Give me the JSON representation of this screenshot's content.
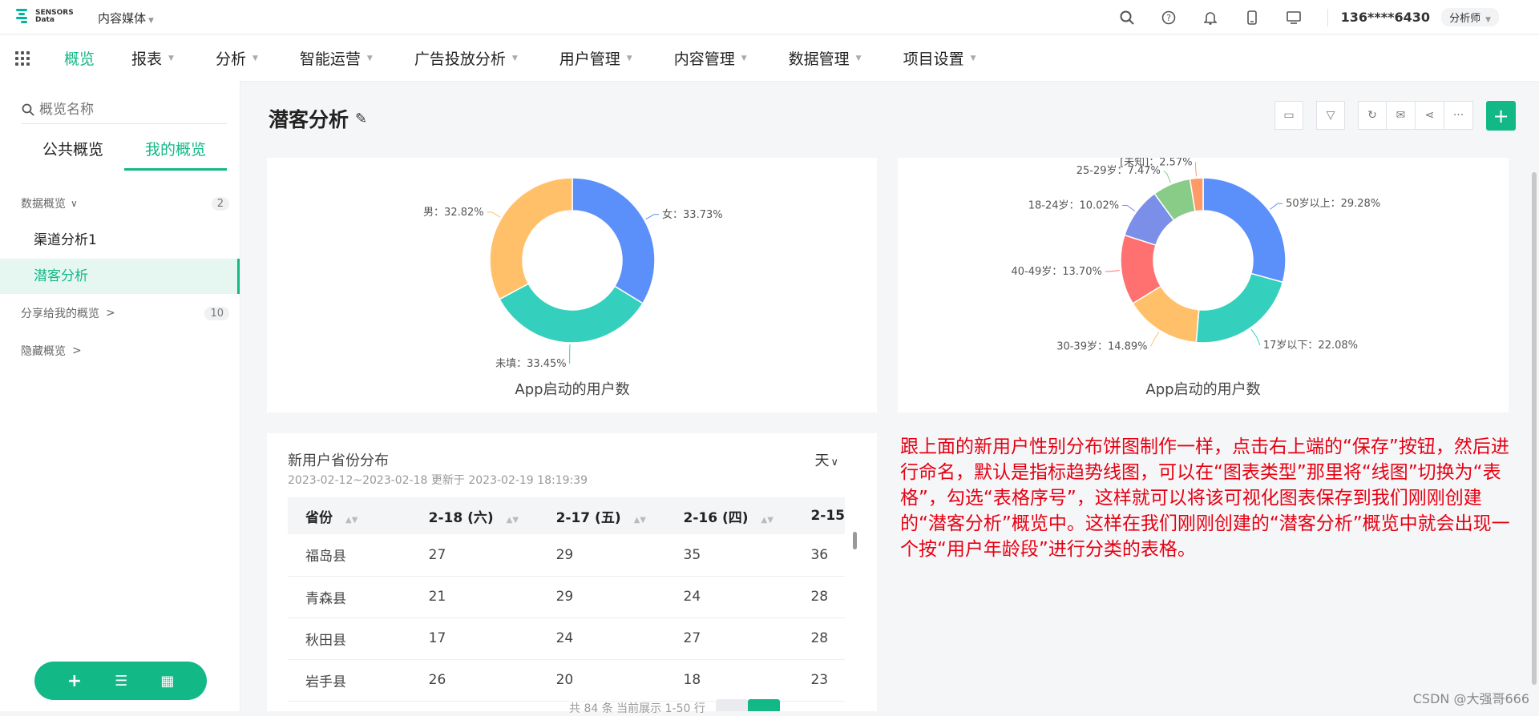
{
  "topbar": {
    "logo_line1": "SENSORS",
    "logo_line2": "Data",
    "app_name": "内容媒体",
    "icons": [
      "search-icon",
      "help-icon",
      "bell-icon",
      "mobile-icon",
      "monitor-icon"
    ],
    "user_phone": "136****6430",
    "role": "分析师"
  },
  "nav": {
    "items": [
      {
        "label": "概览",
        "active": true
      },
      {
        "label": "报表",
        "active": false
      },
      {
        "label": "分析",
        "active": false
      },
      {
        "label": "智能运营",
        "active": false
      },
      {
        "label": "广告投放分析",
        "active": false
      },
      {
        "label": "用户管理",
        "active": false
      },
      {
        "label": "内容管理",
        "active": false
      },
      {
        "label": "数据管理",
        "active": false
      },
      {
        "label": "项目设置",
        "active": false
      }
    ]
  },
  "sidebar": {
    "search_placeholder": "概览名称",
    "tabs": [
      {
        "label": "公共概览",
        "active": false
      },
      {
        "label": "我的概览",
        "active": true
      }
    ],
    "groups": {
      "data": {
        "label": "数据概览",
        "count": "2"
      },
      "shared": {
        "label": "分享给我的概览",
        "count": "10"
      },
      "hidden": {
        "label": "隐藏概览"
      }
    },
    "items": [
      {
        "label": "渠道分析1",
        "active": false
      },
      {
        "label": "潜客分析",
        "active": true
      }
    ]
  },
  "page": {
    "title": "潜客分析"
  },
  "colors": {
    "accent": "#12b886",
    "note_red": "#e60012"
  },
  "chart_data": [
    {
      "type": "pie",
      "subtype": "donut",
      "caption": "App启动的用户数",
      "slices": [
        {
          "label": "女",
          "percent": "33.73%",
          "value": 33.73,
          "color": "#5b8ff9"
        },
        {
          "label": "未填",
          "percent": "33.45%",
          "value": 33.45,
          "color": "#34d0bd"
        },
        {
          "label": "男",
          "percent": "32.82%",
          "value": 32.82,
          "color": "#ffc069"
        }
      ]
    },
    {
      "type": "pie",
      "subtype": "donut",
      "caption": "App启动的用户数",
      "slices": [
        {
          "label": "50岁以上",
          "percent": "29.28%",
          "value": 29.28,
          "color": "#5b8ff9"
        },
        {
          "label": "17岁以下",
          "percent": "22.08%",
          "value": 22.08,
          "color": "#34d0bd"
        },
        {
          "label": "30-39岁",
          "percent": "14.89%",
          "value": 14.89,
          "color": "#ffc069"
        },
        {
          "label": "40-49岁",
          "percent": "13.70%",
          "value": 13.7,
          "color": "#ff7070"
        },
        {
          "label": "18-24岁",
          "percent": "10.02%",
          "value": 10.02,
          "color": "#7b8ee8"
        },
        {
          "label": "25-29岁",
          "percent": "7.47%",
          "value": 7.47,
          "color": "#88cc88"
        },
        {
          "label": "[未知]",
          "percent": "2.57%",
          "value": 2.57,
          "color": "#ff9966"
        }
      ]
    }
  ],
  "table_card": {
    "title": "新用户省份分布",
    "subtitle": "2023-02-12~2023-02-18 更新于 2023-02-19 18:19:39",
    "granularity": "天",
    "columns": [
      "省份",
      "2-18 (六)",
      "2-17 (五)",
      "2-16 (四)",
      "2-15"
    ],
    "rows": [
      [
        "福岛县",
        "27",
        "29",
        "35",
        "36"
      ],
      [
        "青森县",
        "21",
        "29",
        "24",
        "28"
      ],
      [
        "秋田县",
        "17",
        "24",
        "27",
        "28"
      ],
      [
        "岩手县",
        "26",
        "20",
        "18",
        "23"
      ]
    ],
    "pager_text": "共 84 条 当前展示 1-50 行"
  },
  "note": "跟上面的新用户性别分布饼图制作一样，点击右上端的“保存”按钮，然后进行命名，默认是指标趋势线图，可以在“图表类型”那里将“线图”切换为“表格”，勾选“表格序号”，这样就可以将该可视化图表保存到我们刚刚创建的“潜客分析”概览中。这样在我们刚刚创建的“潜客分析”概览中就会出现一个按“用户年龄段”进行分类的表格。",
  "watermark": "CSDN @大强哥666"
}
